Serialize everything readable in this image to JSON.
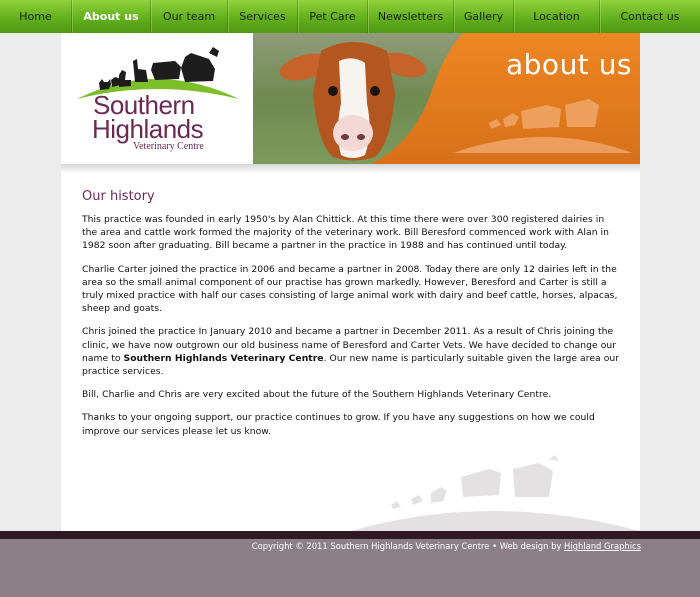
{
  "nav": {
    "items": [
      {
        "label": "Home",
        "active": false
      },
      {
        "label": "About us",
        "active": true
      },
      {
        "label": "Our team",
        "active": false
      },
      {
        "label": "Services",
        "active": false
      },
      {
        "label": "Pet Care",
        "active": false
      },
      {
        "label": "Newsletters",
        "active": false
      },
      {
        "label": "Gallery",
        "active": false
      },
      {
        "label": "Location",
        "active": false
      },
      {
        "label": "Contact us",
        "active": false
      }
    ]
  },
  "logo": {
    "line1": "Southern",
    "line2": "Highlands",
    "line3": "Veterinary Centre"
  },
  "banner": {
    "title": "about us"
  },
  "content": {
    "heading": "Our history",
    "p1": "This practice was founded in early 1950's by Alan Chittick. At this time there were over 300 registered dairies in the area and cattle work formed the majority of the veterinary work. Bill Beresford commenced work with Alan in 1982 soon after graduating. Bill became a partner in the practice in 1988 and has continued until today.",
    "p2": "Charlie Carter joined the practice in 2006 and became a partner in 2008. Today there are only 12 dairies left in the area so the small animal component of our practise has grown markedly. However, Beresford and Carter is still a truly mixed practice with half our cases consisting of large animal work with dairy and beef cattle, horses, alpacas, sheep and goats.",
    "p3_part1": "Chris joined the practice In January 2010 and became a partner in December 2011. As a result of Chris joining the clinic, we have now outgrown our old business name of Beresford and Carter Vets. We have decided to change our name to ",
    "p3_bold": "Southern Highlands Veterinary Centre",
    "p3_part2": ". Our new name is particularly suitable given the large area our practice services.",
    "p4": "Bill, Charlie and Chris are very excited about the future of the Southern Highlands Veterinary Centre.",
    "p5": "Thanks to your ongoing support, our practice continues to grow. If you have any suggestions on how we could improve our services please let us know."
  },
  "footer": {
    "copyright": "Copyright © 2011 Southern Highlands Veterinary Centre • Web design by ",
    "link_label": "Highland Graphics"
  },
  "colors": {
    "nav_green": "#63b01d",
    "brand_purple": "#6b2a55",
    "banner_orange": "#e2781a",
    "footer_gray": "#8c8087",
    "footer_dark": "#2f1a24"
  }
}
